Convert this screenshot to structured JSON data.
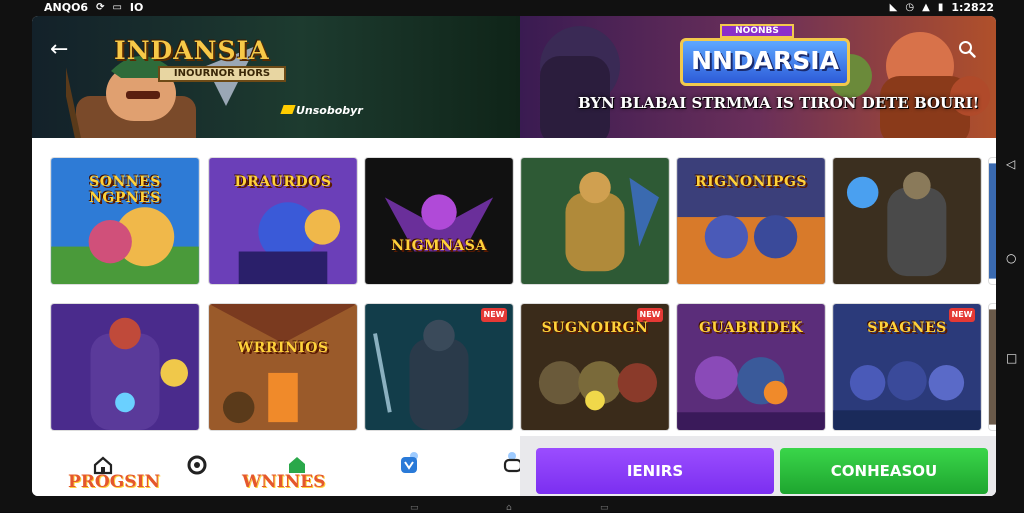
{
  "status_bar": {
    "carrier": "ANQO6",
    "left_icons": [
      "sync-icon",
      "cast-icon"
    ],
    "left_text": "IO",
    "time": "1:2822"
  },
  "banner_left": {
    "title": "INDANSIA",
    "subtitle": "INOURNOR HORS",
    "brand": "Unsobobyr"
  },
  "banner_right": {
    "title": "NNDARSIA",
    "mini_title": "NOONBS",
    "tagline": "BYN BLABAI STRMMA IS TIRON DETE BOURI!"
  },
  "tiles_row1": [
    {
      "label": "SONNES NGPNES",
      "theme": "#2e7bd6"
    },
    {
      "label": "DRAURDOS",
      "theme": "#6b3fb8"
    },
    {
      "label": "NIGMNASA",
      "theme": "#111111"
    },
    {
      "label": "",
      "theme": "#2e5a35"
    },
    {
      "label": "RIGNONIPGS",
      "theme": "#3b3f7a"
    },
    {
      "label": "",
      "theme": "#3b2f1f"
    }
  ],
  "tiles_row2": [
    {
      "label": "",
      "theme": "#4a2b8c",
      "badge": ""
    },
    {
      "label": "WRRINIOS",
      "theme": "#7a3a1f",
      "badge": ""
    },
    {
      "label": "",
      "theme": "#123d4a",
      "badge": "NEW"
    },
    {
      "label": "SUGNOIRGN",
      "theme": "#3a2b1a",
      "badge": "NEW"
    },
    {
      "label": "GUABRIDEK",
      "theme": "#5b2d7a",
      "badge": ""
    },
    {
      "label": "SPAGNES",
      "theme": "#2b3a7a",
      "badge": "NEW"
    }
  ],
  "bottom_nav": {
    "items": [
      "home-icon",
      "circle-icon",
      "store-icon",
      "shield-icon",
      "gamepad-icon"
    ],
    "logos": [
      "PROGSIN",
      "WNINES"
    ]
  },
  "buttons": {
    "primary_label": "IENIRS",
    "secondary_label": "CONHEASOU"
  },
  "colors": {
    "purple_button": "#8b3dff",
    "green_button": "#2bc23b"
  }
}
